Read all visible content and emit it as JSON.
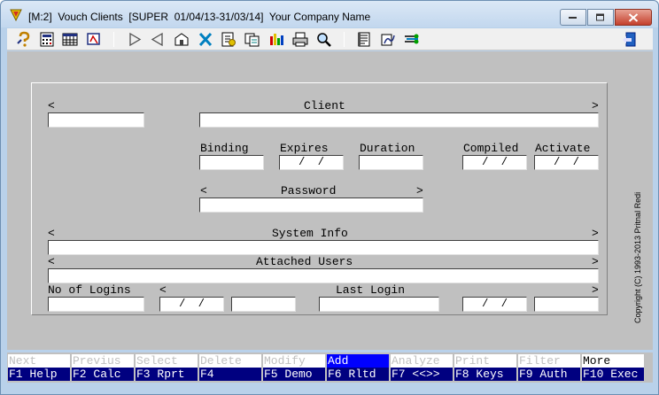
{
  "window": {
    "title": "[M:2]  Vouch Clients  [SUPER  01/04/13-31/03/14]  Your Company Name"
  },
  "toolbar": {
    "icons": [
      "help-icon",
      "calculator-icon",
      "report-icon",
      "select-icon",
      "next-icon",
      "previous-icon",
      "modify-icon",
      "delete-icon",
      "add-icon",
      "copy-icon",
      "chart-icon",
      "print-icon",
      "search-icon",
      "notes-icon",
      "authorise-icon",
      "filter-icon",
      "exit-icon"
    ]
  },
  "form": {
    "left_arrow": "<",
    "right_arrow": ">",
    "client_label": "Client",
    "binding_label": "Binding",
    "expires_label": "Expires",
    "duration_label": "Duration",
    "compiled_label": "Compiled",
    "activate_label": "Activate",
    "password_label": "Password",
    "system_info_label": "System Info",
    "attached_users_label": "Attached Users",
    "no_of_logins_label": "No of Logins",
    "last_login_label": "Last Login",
    "date_placeholder": " /  / "
  },
  "copyright": "Copyright (C) 1993-2013 Pritnal Redi",
  "fkeys": [
    {
      "action": "Next",
      "key": "F1 Help",
      "state": "disabled"
    },
    {
      "action": "Previus",
      "key": "F2 Calc",
      "state": "disabled"
    },
    {
      "action": "Select",
      "key": "F3 Rprt",
      "state": "disabled"
    },
    {
      "action": "Delete",
      "key": "F4",
      "state": "disabled"
    },
    {
      "action": "Modify",
      "key": "F5 Demo",
      "state": "disabled"
    },
    {
      "action": "Add",
      "key": "F6 Rltd",
      "state": "highlight"
    },
    {
      "action": "Analyze",
      "key": "F7 <<>>",
      "state": "disabled"
    },
    {
      "action": "Print",
      "key": "F8 Keys",
      "state": "disabled"
    },
    {
      "action": "Filter",
      "key": "F9 Auth",
      "state": "disabled"
    },
    {
      "action": "More",
      "key": "F10 Exec",
      "state": "enabled"
    }
  ]
}
